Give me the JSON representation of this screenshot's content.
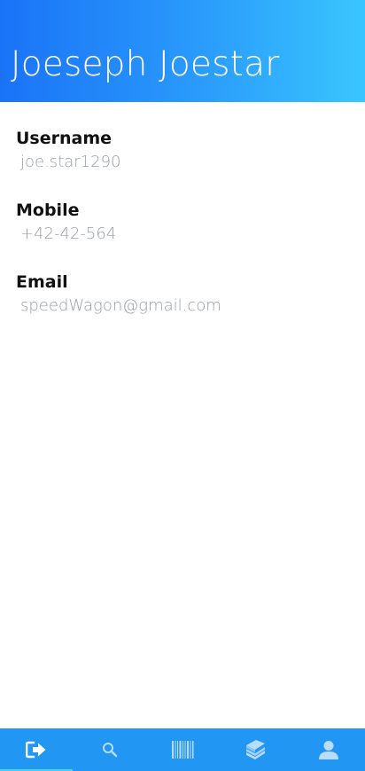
{
  "header": {
    "title": "Joeseph Joestar",
    "gradient_start": "#1a73f7",
    "gradient_end": "#39c6fd"
  },
  "profile": {
    "fields": [
      {
        "label": "Username",
        "value": "joe.star1290"
      },
      {
        "label": "Mobile",
        "value": "+42-42-564"
      },
      {
        "label": "Email",
        "value": "speedWagon@gmail.com"
      }
    ]
  },
  "tabbar": {
    "background": "#2196f3",
    "active_indicator": "#4dd0e1",
    "tabs": [
      {
        "icon": "logout-icon",
        "active": true
      },
      {
        "icon": "search-icon",
        "active": false
      },
      {
        "icon": "barcode-icon",
        "active": false
      },
      {
        "icon": "books-icon",
        "active": false
      },
      {
        "icon": "user-icon",
        "active": false
      }
    ]
  }
}
